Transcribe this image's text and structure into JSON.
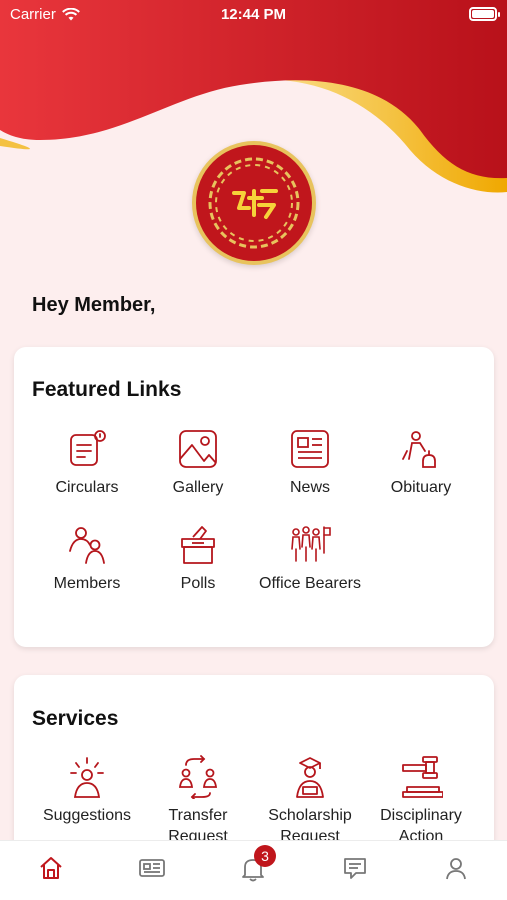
{
  "status_bar": {
    "carrier": "Carrier",
    "time": "12:44 PM"
  },
  "greeting": "Hey Member,",
  "featured": {
    "title": "Featured Links",
    "items": [
      {
        "label": "Circulars",
        "icon": "circulars-icon"
      },
      {
        "label": "Gallery",
        "icon": "gallery-icon"
      },
      {
        "label": "News",
        "icon": "news-icon"
      },
      {
        "label": "Obituary",
        "icon": "obituary-icon"
      },
      {
        "label": "Members",
        "icon": "members-icon"
      },
      {
        "label": "Polls",
        "icon": "polls-icon"
      },
      {
        "label": "Office Bearers",
        "icon": "office-bearers-icon"
      }
    ]
  },
  "services": {
    "title": "Services",
    "items": [
      {
        "label": "Suggestions",
        "icon": "suggestions-icon"
      },
      {
        "label": "Transfer Request",
        "icon": "transfer-request-icon"
      },
      {
        "label": "Scholarship Request",
        "icon": "scholarship-request-icon"
      },
      {
        "label": "Disciplinary Action",
        "icon": "disciplinary-action-icon"
      }
    ]
  },
  "tab_bar": {
    "items": [
      "home-icon",
      "news-tab-icon",
      "notifications-icon",
      "messages-icon",
      "profile-icon"
    ],
    "notification_count": "3"
  },
  "colors": {
    "primary": "#c0161c",
    "gold": "#f2b51e",
    "background": "#fdeeee",
    "icon": "#b5161c"
  }
}
